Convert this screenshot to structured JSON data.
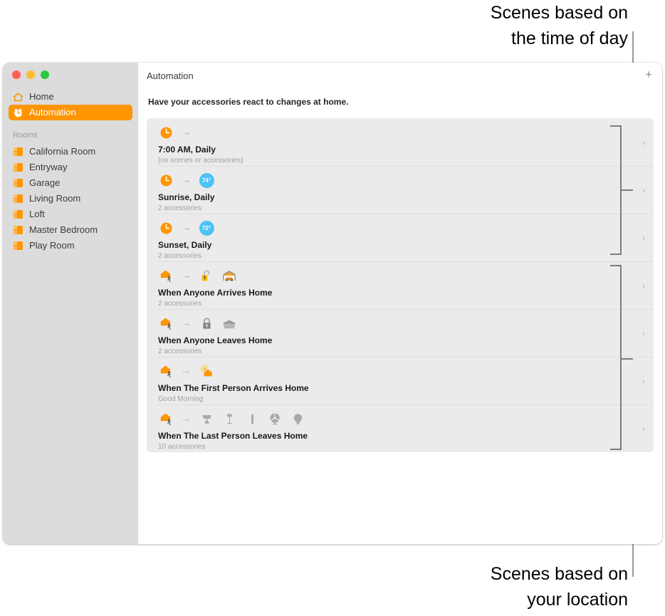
{
  "annotations": {
    "top": "Scenes based on\nthe time of day",
    "bottom": "Scenes based on\nyour location"
  },
  "window": {
    "traffic_lights": [
      {
        "name": "close",
        "color": "#ff5f57"
      },
      {
        "name": "minimize",
        "color": "#febc2e"
      },
      {
        "name": "maximize",
        "color": "#28c840"
      }
    ]
  },
  "sidebar": {
    "items": [
      {
        "label": "Home",
        "icon": "house-icon",
        "selected": false
      },
      {
        "label": "Automation",
        "icon": "automation-clock-icon",
        "selected": true
      }
    ],
    "group_title": "Rooms",
    "rooms": [
      {
        "label": "California Room",
        "icon": "room-icon"
      },
      {
        "label": "Entryway",
        "icon": "room-icon"
      },
      {
        "label": "Garage",
        "icon": "room-icon"
      },
      {
        "label": "Living Room",
        "icon": "room-icon"
      },
      {
        "label": "Loft",
        "icon": "room-icon"
      },
      {
        "label": "Master Bedroom",
        "icon": "room-icon"
      },
      {
        "label": "Play Room",
        "icon": "room-icon"
      }
    ]
  },
  "content": {
    "title": "Automation",
    "add_label": "+",
    "subtitle": "Have your accessories react to changes at home.",
    "chevron": "›",
    "arrow": "→",
    "rows": [
      {
        "title": "7:00 AM, Daily",
        "subtitle": "(no scenes or accessories)",
        "trigger_icon": "clock-icon",
        "action_icons": []
      },
      {
        "title": "Sunrise, Daily",
        "subtitle": "2 accessories",
        "trigger_icon": "clock-icon",
        "action_icons": [
          {
            "type": "temperature-badge",
            "value": "74°"
          }
        ]
      },
      {
        "title": "Sunset, Daily",
        "subtitle": "2 accessories",
        "trigger_icon": "clock-icon",
        "action_icons": [
          {
            "type": "temperature-badge",
            "value": "72°"
          }
        ]
      },
      {
        "title": "When Anyone Arrives Home",
        "subtitle": "2 accessories",
        "trigger_icon": "person-arriving-home-icon",
        "action_icons": [
          {
            "type": "lock-unlocked-icon"
          },
          {
            "type": "garage-door-open-icon"
          }
        ]
      },
      {
        "title": "When Anyone Leaves Home",
        "subtitle": "2 accessories",
        "trigger_icon": "person-leaving-home-icon",
        "action_icons": [
          {
            "type": "lock-locked-icon"
          },
          {
            "type": "garage-door-closed-icon"
          }
        ]
      },
      {
        "title": "When The First Person Arrives Home",
        "subtitle": "Good Morning",
        "trigger_icon": "person-arriving-home-icon",
        "action_icons": [
          {
            "type": "sunrise-home-icon"
          }
        ]
      },
      {
        "title": "When The Last Person Leaves Home",
        "subtitle": "10 accessories",
        "trigger_icon": "person-leaving-home-icon",
        "action_icons": [
          {
            "type": "table-lamp-icon"
          },
          {
            "type": "floor-lamp-icon"
          },
          {
            "type": "light-strip-icon"
          },
          {
            "type": "fan-icon"
          },
          {
            "type": "bulb-icon"
          }
        ]
      }
    ]
  },
  "colors": {
    "accent": "#ff9500",
    "temperature_badge": "#4cc2f5",
    "sidebar_bg": "#dcdcdc",
    "list_bg": "#ebebeb",
    "bracket": "#7d7d7d"
  }
}
